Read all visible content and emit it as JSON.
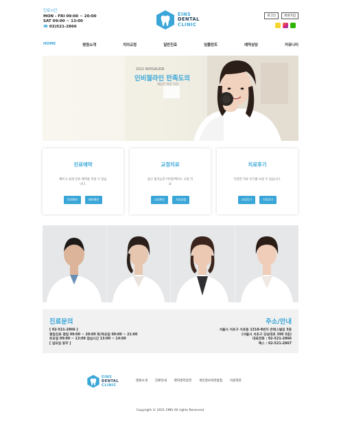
{
  "header": {
    "hours_label": "진료시간",
    "hours_weekday": "MON - FRI 09:00 ~ 20:00",
    "hours_sat": "SAT 09:00 ~ 13:00",
    "phone_prefix": "☎",
    "phone": "02)521-2866",
    "logo": {
      "line1": "EINS",
      "line2": "DENTAL",
      "line3": "CLINIC"
    },
    "util_links": [
      "로그인",
      "회원가입"
    ],
    "social_icons": [
      "kakao-icon",
      "instagram-icon",
      "blog-icon"
    ]
  },
  "nav": {
    "items": [
      "HOME",
      "병원소개",
      "치아교정",
      "일반진료",
      "임플란트",
      "예약상담",
      "커뮤니티"
    ],
    "active": "HOME"
  },
  "hero": {
    "subtitle": "2021 INVISALIGN",
    "title": "인비절라인 만족도의",
    "caption": "해답은 바로 이것"
  },
  "cards": [
    {
      "title": "진료예약",
      "desc": "빠르고 쉽게 진료 예약을 하실 수 있습니다.",
      "buttons": [
        "진료예약",
        "예약확인"
      ]
    },
    {
      "title": "교정치료",
      "desc": "쉽고 불가능한 어려운케이스 교정 치료",
      "buttons": [
        "교정확인",
        "치료방법"
      ]
    },
    {
      "title": "치료후기",
      "desc": "다양한 치료 후기를 보실 수 있습니다.",
      "buttons": [
        "교정후기",
        "치료후기"
      ]
    }
  ],
  "info": {
    "left_title": "진료문의",
    "left_lines": [
      "[ 02-521-2866 ]",
      "평일진료 평일 09:00 ~ 20:00 화/목요일 09:00 ~ 21:00",
      "토요일 09:00 ~ 13:00 점심시간 13:00 ~ 14:00",
      "[ 일요일 휴무 ]"
    ],
    "right_title": "주소/안내",
    "right_lines": [
      "서울시 서초구 서초동 1318-8번지 온테스빌딩 3층",
      "(서울시 서초구 강남대로 399 3층)",
      "대표전화 : 02-521-2866",
      "팩스 : 02-521-2867"
    ]
  },
  "footer": {
    "logo": {
      "line1": "EINS",
      "line2": "DENTAL",
      "line3": "CLINIC"
    },
    "links": [
      "병원소개",
      "진료안내",
      "환자권리장전",
      "개인정보처리방침",
      "이용약관"
    ],
    "copyright": "Copyright © 2021 EINS All rights Reserved."
  },
  "colors": {
    "accent": "#3aa6d8",
    "navy": "#1f3a52",
    "panel": "#f1f1f1"
  }
}
